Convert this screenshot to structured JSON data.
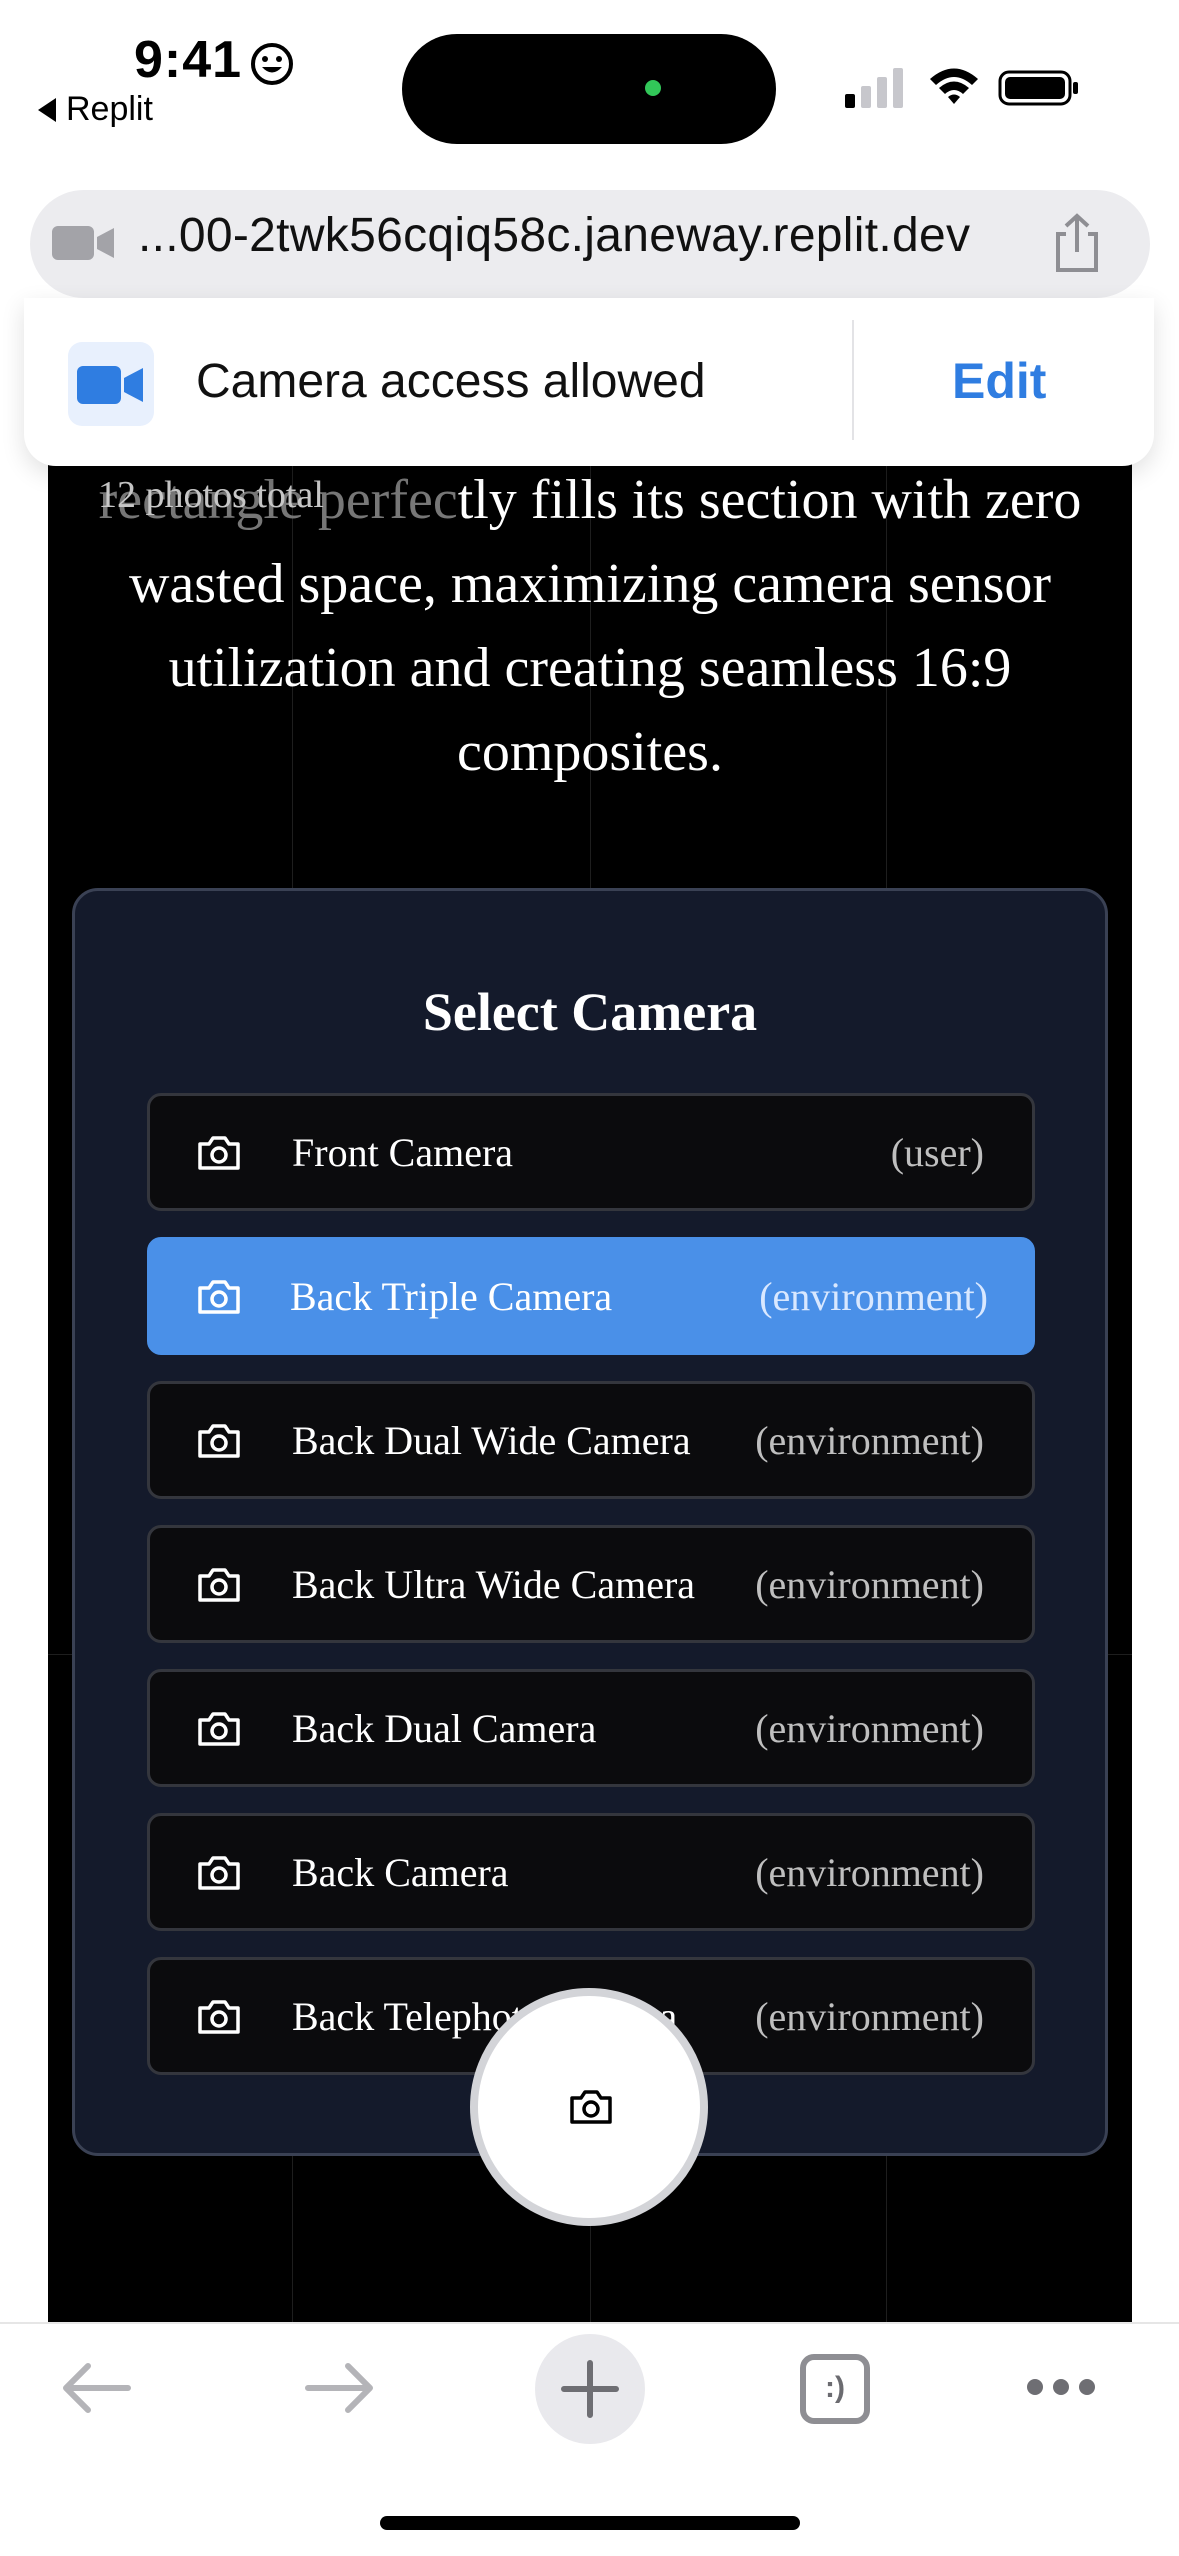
{
  "status_bar": {
    "time": "9:41",
    "back_app_label": "Replit"
  },
  "browser": {
    "url": "...00-2twk56cqiq58c.janeway.replit.dev"
  },
  "permission_banner": {
    "message": "Camera access allowed",
    "action_label": "Edit"
  },
  "page": {
    "photo_count": "12 photos total",
    "description_faded": "rectangle perfec",
    "description_rest": "tly fills its section with zero wasted space, maximizing camera sensor utilization and creating seamless 16:9 composites."
  },
  "camera_panel": {
    "title": "Select Camera",
    "cameras": [
      {
        "name": "Front Camera",
        "facing": "(user)",
        "selected": false
      },
      {
        "name": "Back Triple Camera",
        "facing": "(environment)",
        "selected": true
      },
      {
        "name": "Back Dual Wide Camera",
        "facing": "(environment)",
        "selected": false
      },
      {
        "name": "Back Ultra Wide Camera",
        "facing": "(environment)",
        "selected": false
      },
      {
        "name": "Back Dual Camera",
        "facing": "(environment)",
        "selected": false
      },
      {
        "name": "Back Camera",
        "facing": "(environment)",
        "selected": false
      },
      {
        "name": "Back Telephoto Camera",
        "facing": "(environment)",
        "selected": false
      }
    ]
  },
  "toolbar": {
    "tabs_label": ":)"
  },
  "colors": {
    "accent": "#4a90e8",
    "link_blue": "#2f7de1",
    "panel_bg": "#141a2b"
  },
  "icons": [
    "smiley-icon",
    "signal-icon",
    "wifi-icon",
    "battery-icon",
    "video-camera-icon",
    "share-icon",
    "camera-icon",
    "back-arrow-icon",
    "forward-arrow-icon",
    "plus-icon",
    "tabs-icon",
    "more-icon"
  ]
}
